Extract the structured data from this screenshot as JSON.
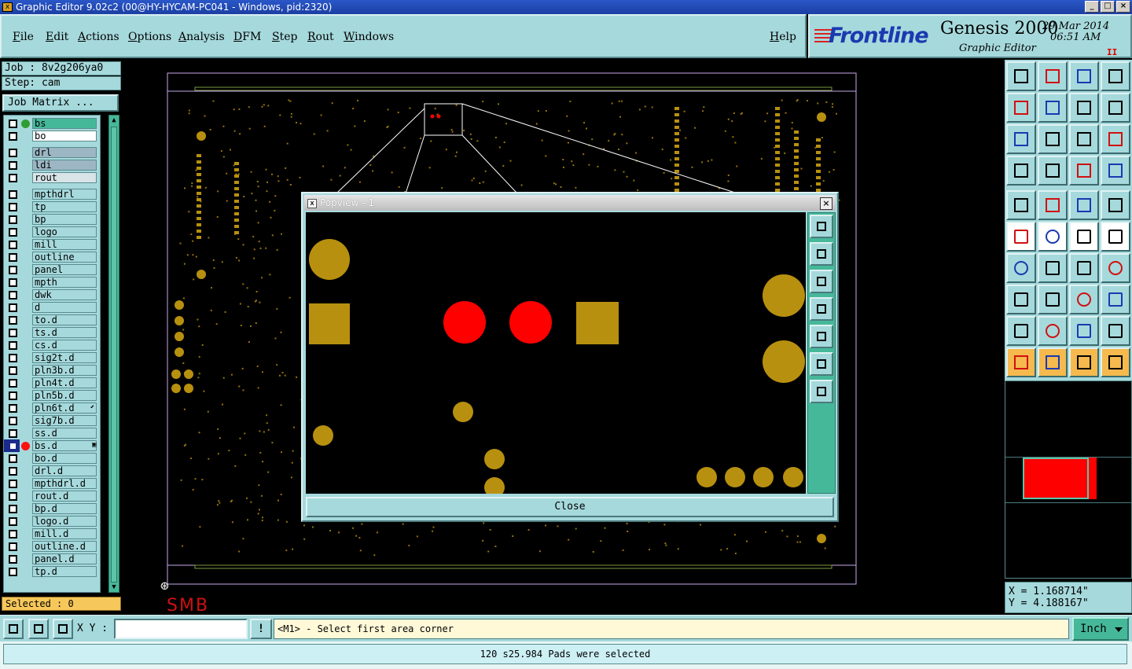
{
  "window": {
    "title": "Graphic Editor 9.02c2 (00@HY-HYCAM-PC041 - Windows, pid:2320)",
    "controls": [
      "_",
      "□",
      "×"
    ]
  },
  "menu": {
    "items": [
      "File",
      "Edit",
      "Actions",
      "Options",
      "Analysis",
      "DFM",
      "Step",
      "Rout",
      "Windows"
    ],
    "help": "Help"
  },
  "brand": {
    "logo": "Frontline",
    "product": "Genesis 2000",
    "subtitle": "Graphic Editor",
    "date": "29 Mar 2014",
    "time": "06:51 AM",
    "pause_icon": "II"
  },
  "left": {
    "job": "Job : 8v2g206ya0",
    "step": "Step: cam",
    "job_matrix": "Job Matrix ...",
    "selected": "Selected : 0"
  },
  "layers": [
    {
      "name": "bs",
      "color": "#46b89a",
      "status": "work"
    },
    {
      "name": "bo",
      "color": "#ffffff",
      "status": "white"
    },
    {
      "name": "drl",
      "color": "#9cb6c4",
      "status": ""
    },
    {
      "name": "ldi",
      "color": "#9cb6c4",
      "status": ""
    },
    {
      "name": "rout",
      "color": "#d8e4e8",
      "status": ""
    },
    {
      "name": "mpthdrl",
      "status": ""
    },
    {
      "name": "tp",
      "status": ""
    },
    {
      "name": "bp",
      "status": ""
    },
    {
      "name": "logo",
      "status": ""
    },
    {
      "name": "mill",
      "status": ""
    },
    {
      "name": "outline",
      "status": ""
    },
    {
      "name": "panel",
      "status": ""
    },
    {
      "name": "mpth",
      "status": ""
    },
    {
      "name": "dwk",
      "status": ""
    },
    {
      "name": "d",
      "status": ""
    },
    {
      "name": "to.d",
      "status": ""
    },
    {
      "name": "ts.d",
      "status": ""
    },
    {
      "name": "cs.d",
      "status": ""
    },
    {
      "name": "sig2t.d",
      "status": ""
    },
    {
      "name": "pln3b.d",
      "status": ""
    },
    {
      "name": "pln4t.d",
      "status": ""
    },
    {
      "name": "pln5b.d",
      "status": ""
    },
    {
      "name": "pln6t.d",
      "status": "flag"
    },
    {
      "name": "sig7b.d",
      "status": ""
    },
    {
      "name": "ss.d",
      "status": ""
    },
    {
      "name": "bs.d",
      "status": "active"
    },
    {
      "name": "bo.d",
      "status": ""
    },
    {
      "name": "drl.d",
      "status": ""
    },
    {
      "name": "mpthdrl.d",
      "status": ""
    },
    {
      "name": "rout.d",
      "status": ""
    },
    {
      "name": "bp.d",
      "status": ""
    },
    {
      "name": "logo.d",
      "status": ""
    },
    {
      "name": "mill.d",
      "status": ""
    },
    {
      "name": "outline.d",
      "status": ""
    },
    {
      "name": "panel.d",
      "status": ""
    },
    {
      "name": "tp.d",
      "status": ""
    }
  ],
  "canvas": {
    "label": "SMB",
    "colors": {
      "copper": "#b8900f",
      "highlight": "#ff0000",
      "outline": "#c8a8e8"
    }
  },
  "popview": {
    "title": "Popview - 1",
    "close_button": "Close",
    "close_x": "×"
  },
  "coords": {
    "x": "X =  1.168714\"",
    "y": "Y =  4.188167\""
  },
  "cmdbar": {
    "xy_label": "X Y :",
    "xy_value": "",
    "warn": "!",
    "prompt": "<M1> - Select first area corner",
    "units": "Inch"
  },
  "status": {
    "message": "120 s25.984 Pads were selected"
  },
  "tool_icons": [
    "open-icon",
    "save-icon",
    "home-icon",
    "window-icon",
    "prev-icon",
    "next-icon",
    "zoom-back-icon",
    "redraw-icon",
    "fit-icon",
    "center-icon",
    "ratio-icon",
    "help-icon",
    "measure-icon",
    "grid-icon",
    "layer-display-icon",
    "layer-compare-icon",
    "add-pad-icon",
    "add-line-icon",
    "ruler-icon",
    "surface-icon",
    "node-icon",
    "cross-icon",
    "arc-icon",
    "arc-ccw-icon",
    "angle-icon",
    "slash-icon",
    "undo-arc-icon",
    "swap-icon",
    "pad-select-icon",
    "line-split-icon",
    "frame-icon",
    "shape-icon",
    "triangle-a-icon",
    "triangle-b-icon",
    "triangle-c-icon",
    "triangle-d-icon",
    "pointer-icon",
    "select-pointer-icon",
    "zoom-pointer-icon",
    "net-icon"
  ]
}
